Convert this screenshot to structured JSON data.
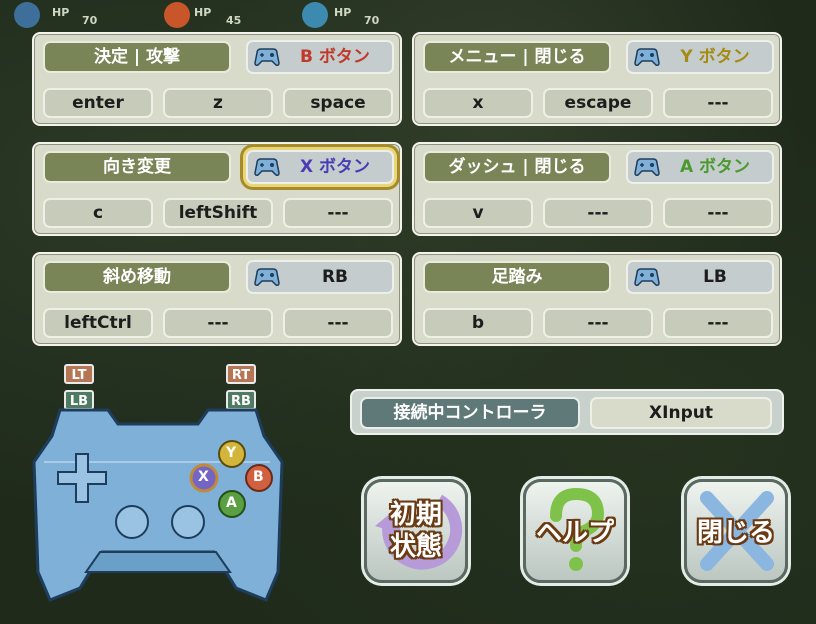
{
  "hud": {
    "hp_labels": [
      "HP",
      "HP",
      "HP"
    ],
    "hp_values": [
      "70",
      "45",
      "70"
    ]
  },
  "bindings": [
    {
      "action": "決定 | 攻撃",
      "pad_button": "B ボタン",
      "pad_color": "#c0392b",
      "keys": [
        "enter",
        "z",
        "space"
      ],
      "selected": false
    },
    {
      "action": "メニュー | 閉じる",
      "pad_button": "Y ボタン",
      "pad_color": "#a58b14",
      "keys": [
        "x",
        "escape",
        "---"
      ],
      "selected": false
    },
    {
      "action": "向き変更",
      "pad_button": "X ボタン",
      "pad_color": "#4b3cb4",
      "keys": [
        "c",
        "leftShift",
        "---"
      ],
      "selected": true
    },
    {
      "action": "ダッシュ | 閉じる",
      "pad_button": "A ボタン",
      "pad_color": "#4a9a2e",
      "keys": [
        "v",
        "---",
        "---"
      ],
      "selected": false
    },
    {
      "action": "斜め移動",
      "pad_button": "RB",
      "pad_color": "#1d1d1d",
      "keys": [
        "leftCtrl",
        "---",
        "---"
      ],
      "selected": false
    },
    {
      "action": "足踏み",
      "pad_button": "LB",
      "pad_color": "#1d1d1d",
      "keys": [
        "b",
        "---",
        "---"
      ],
      "selected": false
    }
  ],
  "controller_diagram": {
    "lt": "LT",
    "lb": "LB",
    "rt": "RT",
    "rb": "RB",
    "y": "Y",
    "x": "X",
    "b": "B",
    "a": "A",
    "icon": "gamepad-icon"
  },
  "connection": {
    "label": "接続中コントローラ",
    "value": "XInput"
  },
  "buttons": {
    "reset": "初期\n状態",
    "reset_line1": "初期",
    "reset_line2": "状態",
    "help": "ヘルプ",
    "close": "閉じる"
  },
  "colors": {
    "action_bg": "#7a8557",
    "panel_bg": "#d8dbc9",
    "selected_outline": "#a58b2c"
  }
}
